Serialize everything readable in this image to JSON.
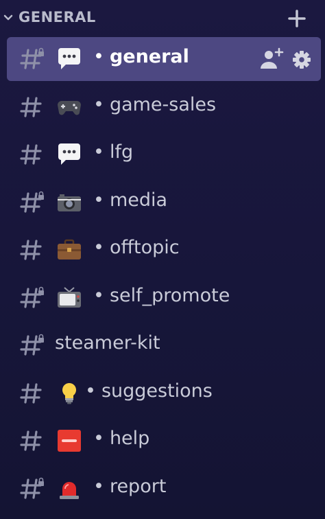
{
  "category": {
    "label": "GENERAL",
    "collapse_icon": "chevron-down-icon",
    "add_icon": "plus-icon"
  },
  "colors": {
    "background": "#1b1840",
    "selected": "#4d4882",
    "text": "#c9cbd8",
    "selected_text": "#ffffff"
  },
  "channels": [
    {
      "label": "general",
      "prefix": "•",
      "emoji": "speech-bubble-icon",
      "locked": true,
      "selected": true,
      "actions": [
        "add-member-icon",
        "gear-icon"
      ]
    },
    {
      "label": "game-sales",
      "prefix": "•",
      "emoji": "game-controller-icon",
      "locked": false
    },
    {
      "label": "lfg",
      "prefix": "•",
      "emoji": "speech-bubble-icon",
      "locked": false
    },
    {
      "label": "media",
      "prefix": "•",
      "emoji": "camera-icon",
      "locked": true
    },
    {
      "label": "offtopic",
      "prefix": "•",
      "emoji": "briefcase-icon",
      "locked": false
    },
    {
      "label": "self_promote",
      "prefix": "•",
      "emoji": "television-icon",
      "locked": true
    },
    {
      "label": "steamer-kit",
      "prefix": "",
      "emoji": "",
      "locked": true
    },
    {
      "label": "suggestions",
      "prefix": "•",
      "emoji": "light-bulb-icon",
      "locked": false
    },
    {
      "label": "help",
      "prefix": "•",
      "emoji": "sos-icon",
      "locked": false
    },
    {
      "label": "report",
      "prefix": "•",
      "emoji": "siren-icon",
      "locked": true
    }
  ]
}
